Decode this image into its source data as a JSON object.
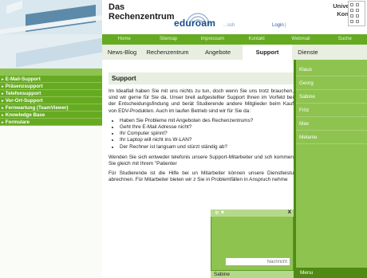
{
  "header": {
    "title_line1": "Das",
    "title_line2": "Rechenzentrum",
    "eduroam_text": "eduroam",
    "eduroam_sub": "...ssh",
    "login_label": "Login",
    "login_sep": "|",
    "university_line1": "Universität",
    "university_line2": "Konstanz"
  },
  "nav": [
    "Home",
    "Sitemap",
    "Impressum",
    "Kontakt",
    "Webmail",
    "Suche"
  ],
  "tabs": [
    {
      "label": "News-Blog",
      "active": false
    },
    {
      "label": "Rechenzentrum",
      "active": false
    },
    {
      "label": "Angebote",
      "active": false
    },
    {
      "label": "Support",
      "active": true
    },
    {
      "label": "Dienste",
      "active": false
    }
  ],
  "sidebar": {
    "items": [
      {
        "label": "E-Mail-Support"
      },
      {
        "label": "Präsenzsupport"
      },
      {
        "label": "Telefonsupport"
      },
      {
        "label": "Vor-Ort-Support"
      },
      {
        "label": "Fernwartung (TeamViewer)"
      },
      {
        "label": "Knowledge Base"
      },
      {
        "label": "Formulare"
      }
    ]
  },
  "main": {
    "section_title": "Support",
    "intro": "Im Idealfall haben Sie mit uns nichts zu tun, doch wenn Sie uns trotz brauchen, sind wir gerne für Sie da. Unser breit aufgestellter Support Ihnen im Vorfeld bei der Entscheidungsfindung und berät Studierende andere Mitglieder beim Kauf von EDV-Produkten. Auch im laufen Betrieb sind wir für Sie da:",
    "bullets": [
      "Haben Sie Probleme mit Angeboten des Rechenzentrums?",
      "Geht Ihre E-Mail Adresse nicht?",
      "Ihr Computer spinnt?",
      "Ihr Laptop will nicht ins W-LAN?",
      "Der Rechner ist langsam und stürzt ständig ab?"
    ],
    "para2": "Wenden Sie sich entweder telefonis unsere Support-Mitarbeiter und sch kommen Sie gleich mit Ihrem \"Patienter",
    "para3": "Für Studierende ist die Hilfe bei un Mitarbeiter können unsere Dienstleistu abrechnen. Für Mitarbeiter bieten wir z Sie in Problemfällen in Anspruch nehme"
  },
  "chat_users": [
    "Klaus",
    "Georg",
    "Sabine",
    "Fritz",
    "Max",
    "Melanie"
  ],
  "chat_footer": "Menu",
  "chat_popup": {
    "close_label": "X",
    "input_placeholder": "Nachricht",
    "contact_name": "Sabine"
  },
  "colors": {
    "accent_green": "#66aa22",
    "light_green": "#8ec350",
    "tab_bg": "#e8eee0"
  }
}
